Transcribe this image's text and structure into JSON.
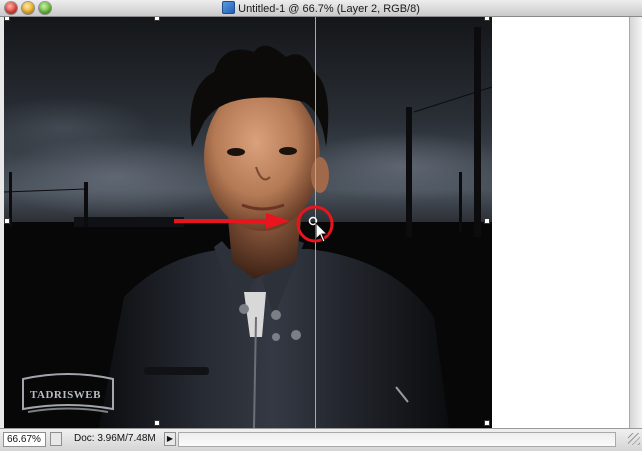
{
  "window": {
    "title": "Untitled-1 @ 66.7% (Layer 2, RGB/8)"
  },
  "status": {
    "zoom": "66.67%",
    "doc_info": "Doc: 3.96M/7.48M",
    "menu_arrow": "▶"
  },
  "watermark": {
    "text": "TADRISWEB"
  },
  "colors": {
    "guide": "#37d6ee",
    "annotation_red": "#e8141e"
  },
  "icons": {
    "document": "photoshop-document-icon",
    "cursor": "arrow-pointer-icon"
  }
}
